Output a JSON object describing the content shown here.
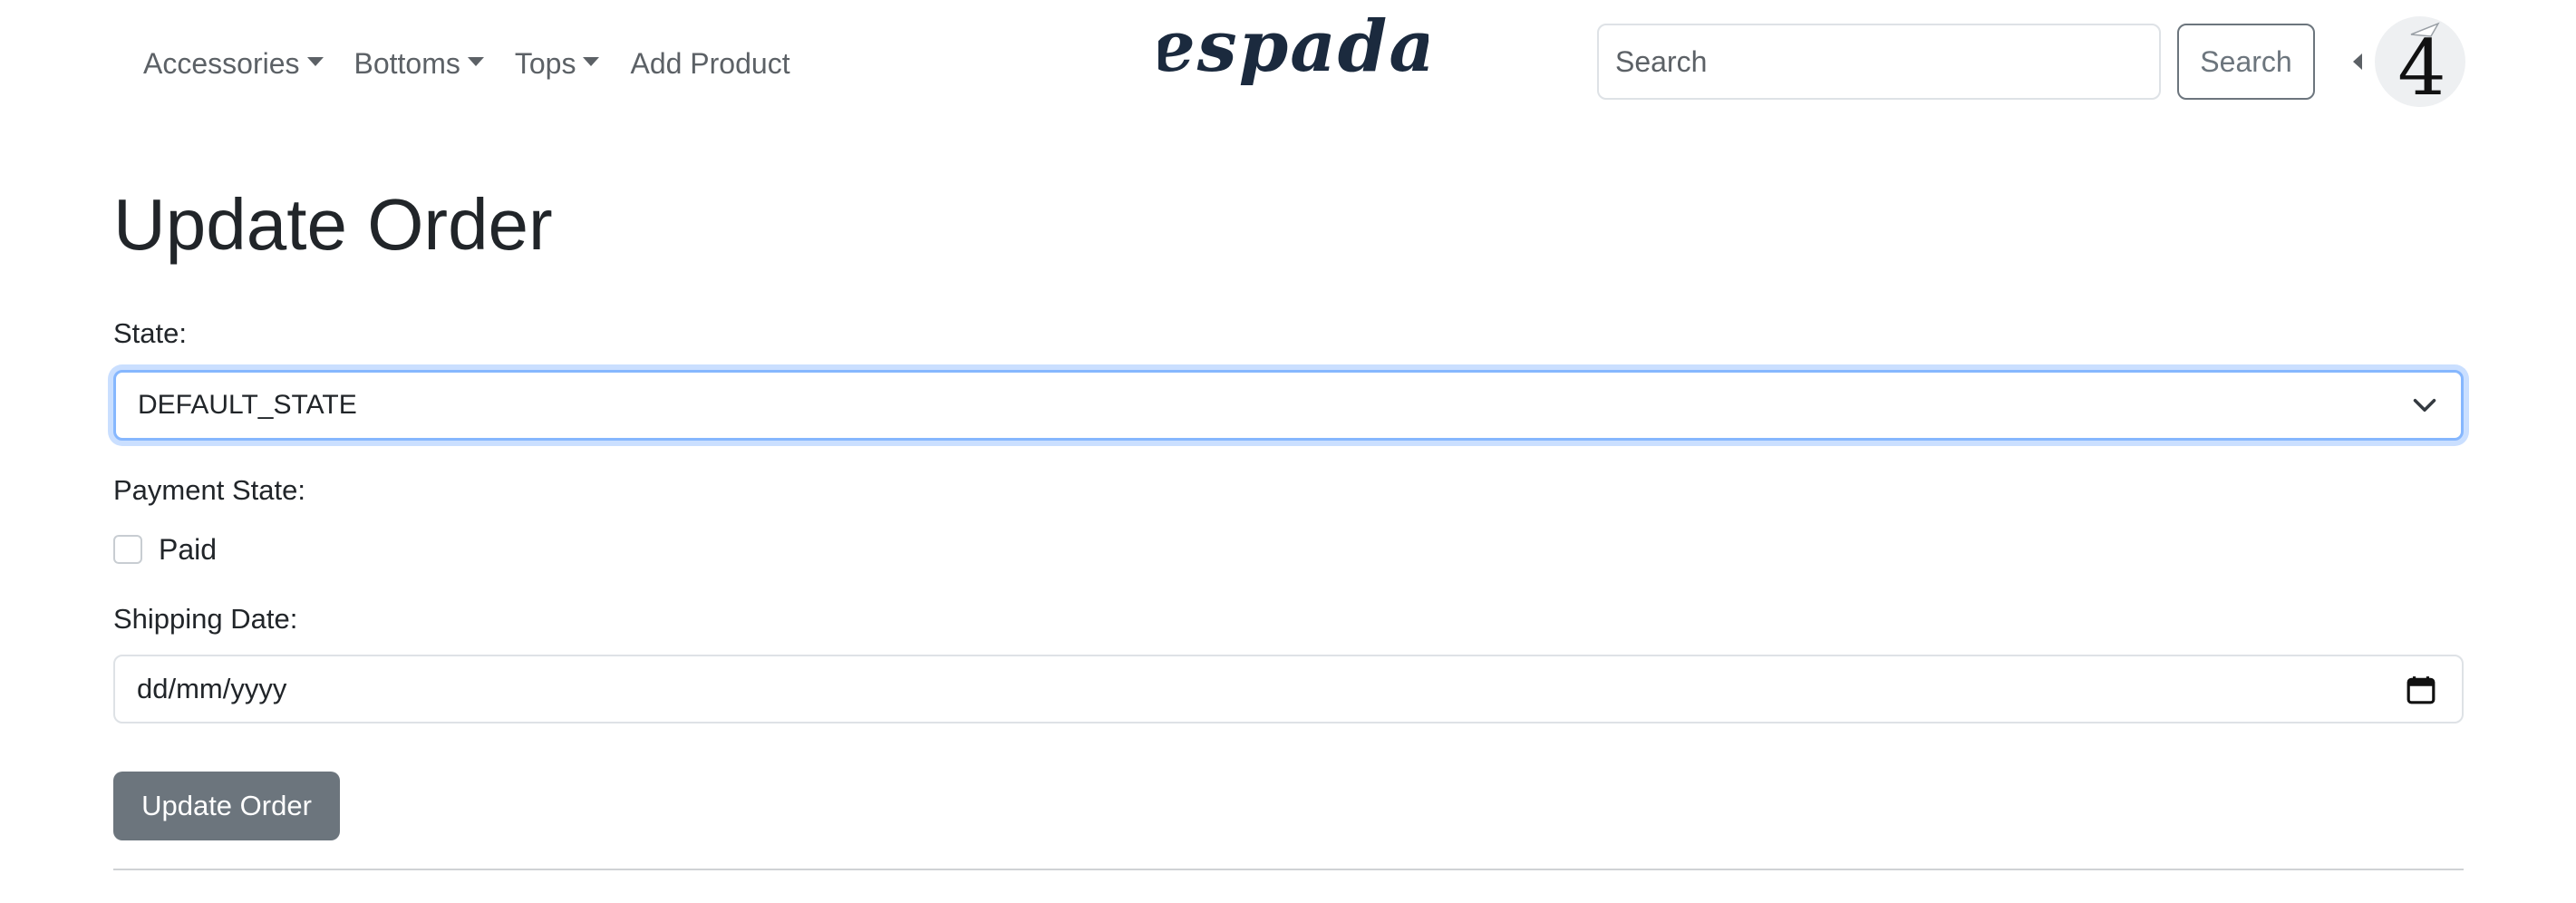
{
  "nav": {
    "links": [
      {
        "label": "Accessories",
        "dropdown": true
      },
      {
        "label": "Bottoms",
        "dropdown": true
      },
      {
        "label": "Tops",
        "dropdown": true
      },
      {
        "label": "Add Product",
        "dropdown": false
      }
    ],
    "brand": "espada",
    "search": {
      "placeholder": "Search",
      "value": "",
      "button_label": "Search"
    },
    "user_menu": {
      "avatar_icon": "avatar-4-icon",
      "avatar_text": "4"
    }
  },
  "form": {
    "title": "Update Order",
    "state_label": "State:",
    "state_value": "DEFAULT_STATE",
    "payment_label": "Payment State:",
    "paid_label": "Paid",
    "paid_checked": false,
    "shipping_label": "Shipping Date:",
    "shipping_placeholder": "dd/mm/yyyy",
    "submit_label": "Update Order"
  },
  "colors": {
    "brand": "#1b2a3e",
    "nav_text": "#5c6166",
    "focus_ring": "#86b7fe",
    "secondary_button": "#6c757d"
  }
}
